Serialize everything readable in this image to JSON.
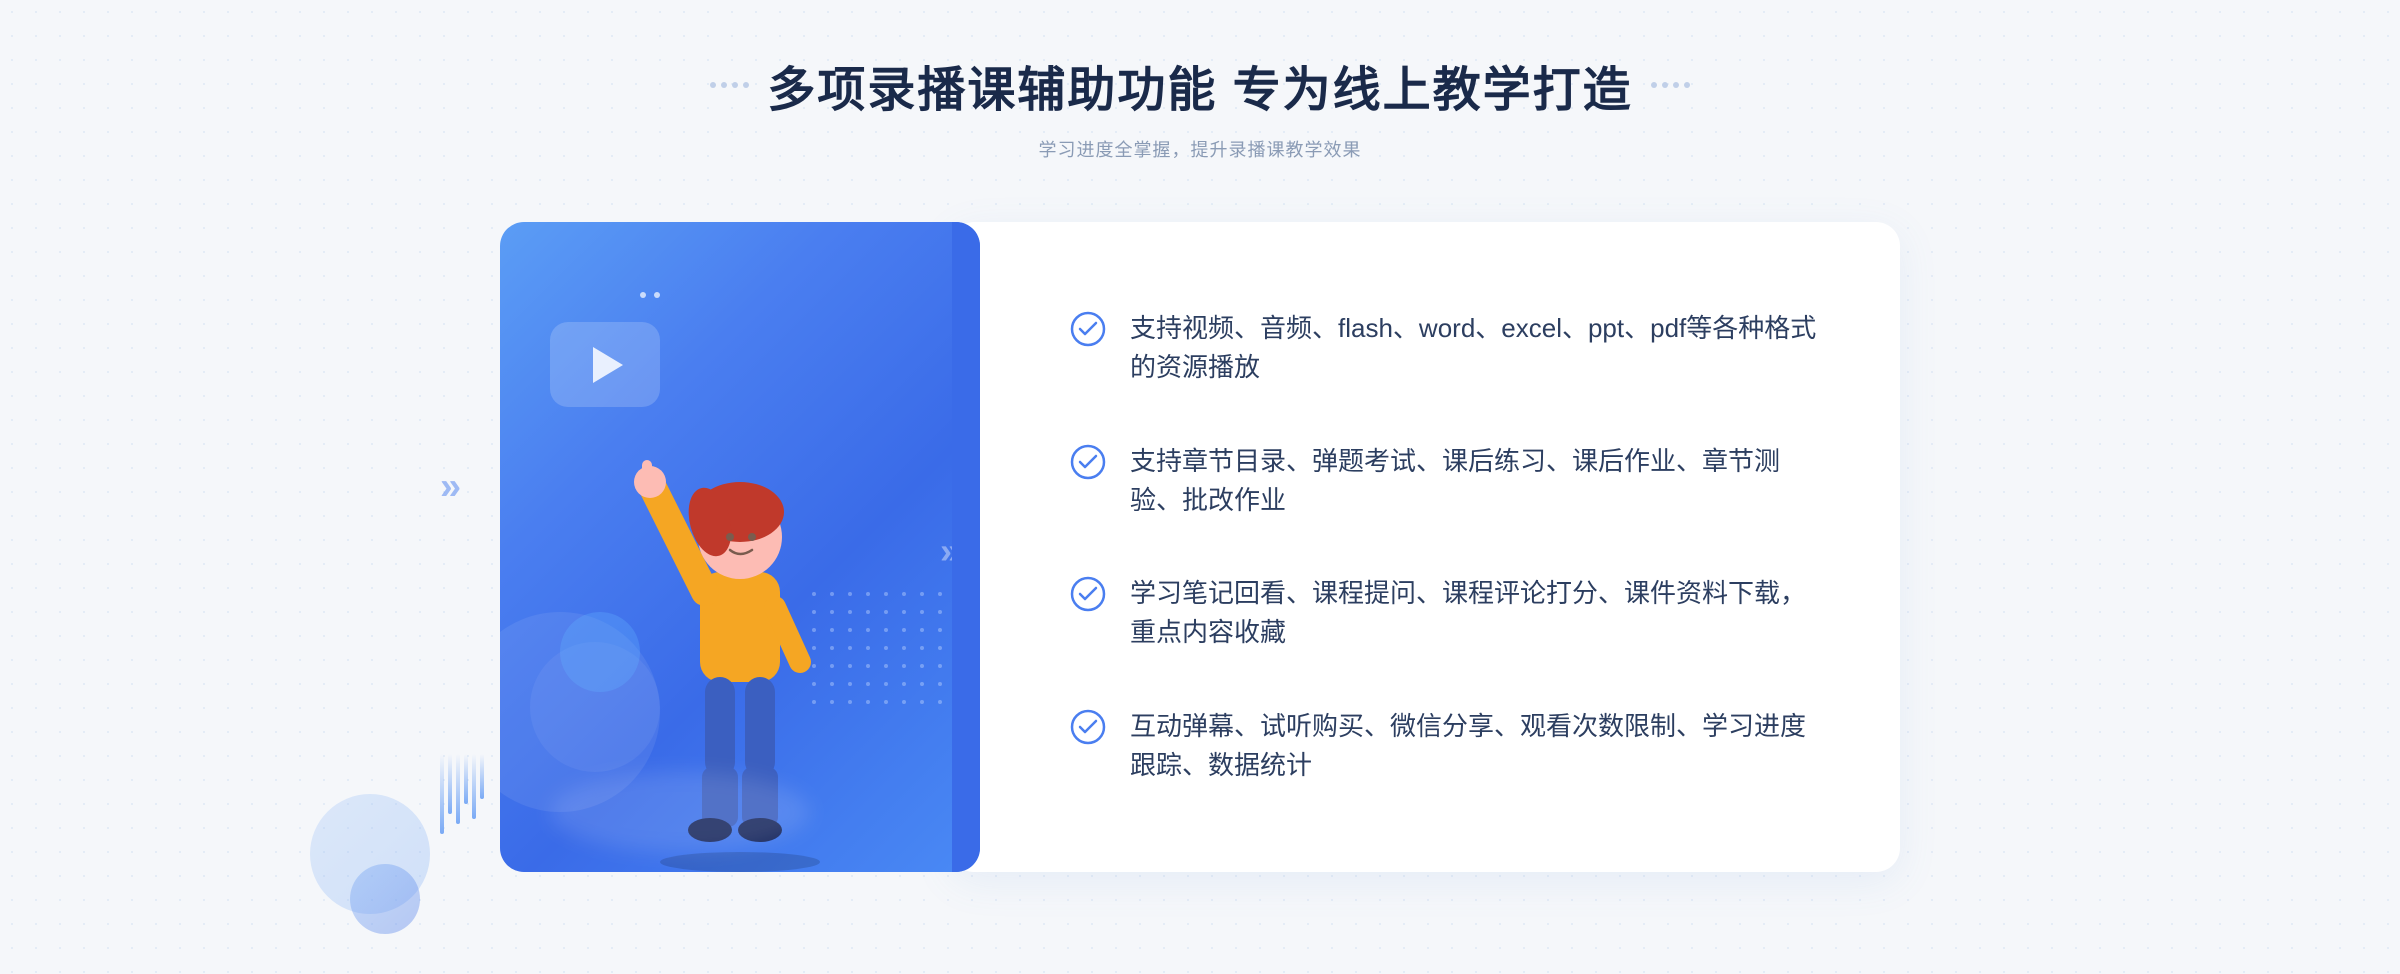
{
  "header": {
    "main_title": "多项录播课辅助功能 专为线上教学打造",
    "subtitle": "学习进度全掌握，提升录播课教学效果"
  },
  "features": [
    {
      "id": "feature-1",
      "text": "支持视频、音频、flash、word、excel、ppt、pdf等各种格式的资源播放"
    },
    {
      "id": "feature-2",
      "text": "支持章节目录、弹题考试、课后练习、课后作业、章节测验、批改作业"
    },
    {
      "id": "feature-3",
      "text": "学习笔记回看、课程提问、课程评论打分、课件资料下载，重点内容收藏"
    },
    {
      "id": "feature-4",
      "text": "互动弹幕、试听购买、微信分享、观看次数限制、学习进度跟踪、数据统计"
    }
  ],
  "icons": {
    "check": "check-circle-icon",
    "play": "play-icon",
    "left_arrow": "left-arrow-icon",
    "right_arrow": "right-arrow-icon"
  },
  "colors": {
    "primary": "#4a7ef0",
    "title": "#1a2a4a",
    "subtitle": "#8a9bb5",
    "text": "#2c3e60",
    "gradient_start": "#5b9df5",
    "gradient_end": "#3a6be8"
  }
}
